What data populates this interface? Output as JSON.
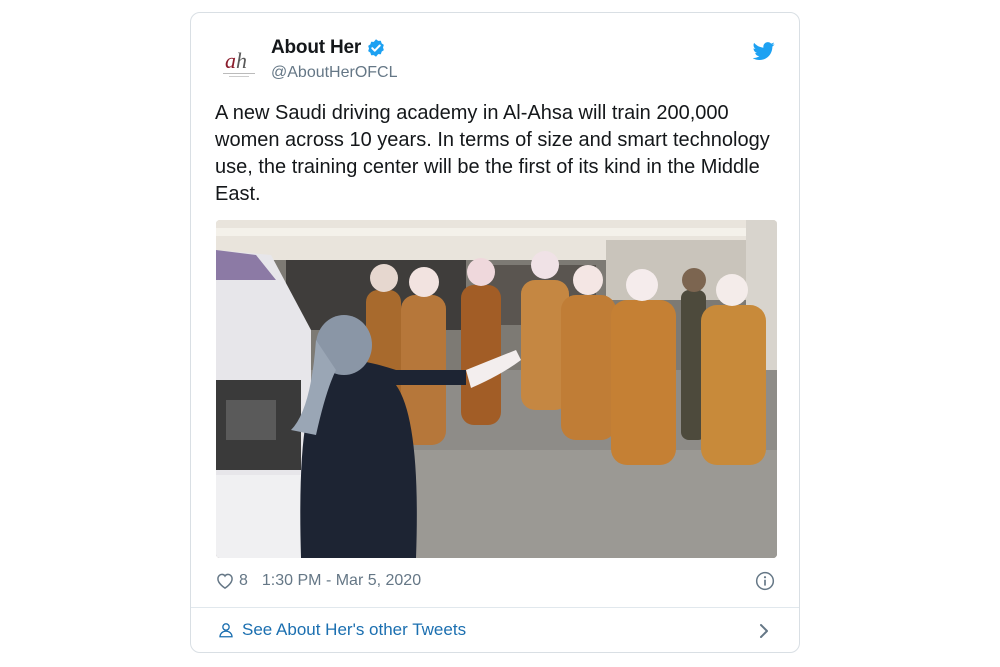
{
  "tweet": {
    "author": {
      "display_name": "About Her",
      "handle": "@AboutHerOFCL",
      "verified": true,
      "avatar_icon": "about-her-logo"
    },
    "text": "A new Saudi driving academy in Al-Ahsa will train 200,000 women across 10 years. In terms of size and smart technology use, the training center will be the first of its kind in the Middle East.",
    "media": {
      "type": "photo"
    },
    "likes": "8",
    "timestamp": "1:30 PM - Mar 5, 2020",
    "footer_link": "See About Her's other Tweets"
  },
  "colors": {
    "twitter_blue": "#1da1f2",
    "link_blue": "#1b6fb0",
    "muted_gray": "#657786",
    "border": "#d9dfe4"
  },
  "icons": {
    "brand": "twitter-bird-icon",
    "verified": "verified-badge-icon",
    "like": "heart-icon",
    "info": "info-icon",
    "profile": "person-icon",
    "navigate": "chevron-right-icon"
  }
}
